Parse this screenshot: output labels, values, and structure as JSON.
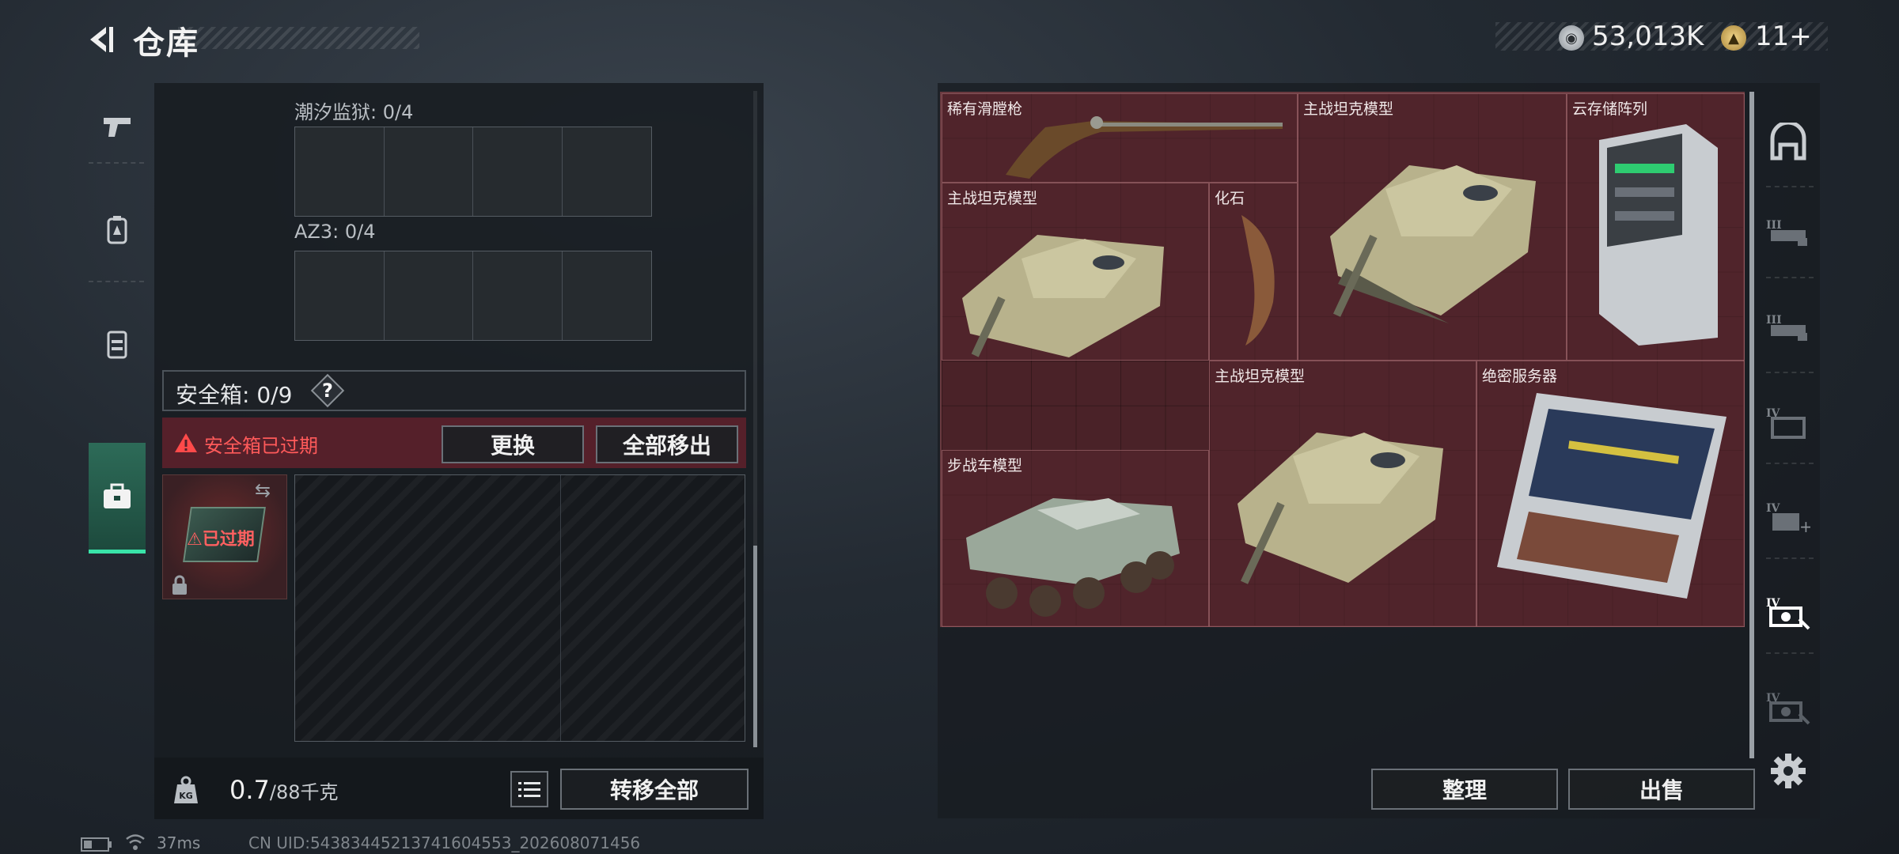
{
  "header": {
    "title": "仓库",
    "coin_value": "53,013K",
    "token_value": "11+"
  },
  "left_tabs": [
    "pistol-icon",
    "backpack-icon",
    "vest-icon",
    "safebox-icon"
  ],
  "storage": {
    "sections": [
      {
        "label": "潮汐监狱: 0/4"
      },
      {
        "label": "AZ3: 0/4"
      }
    ],
    "safebox": {
      "label": "安全箱: 0/9",
      "help": "?",
      "expired_message": "安全箱已过期",
      "replace_label": "更换",
      "remove_all_label": "全部移出",
      "item_status": "已过期"
    },
    "weight_current": "0.7",
    "weight_max": "/88千克",
    "transfer_all_label": "转移全部"
  },
  "stash": {
    "items": [
      {
        "label": "稀有滑膛枪"
      },
      {
        "label": "主战坦克模型"
      },
      {
        "label": "云存储阵列"
      },
      {
        "label": "主战坦克模型"
      },
      {
        "label": "化石"
      },
      {
        "label": "主战坦克模型"
      },
      {
        "label": "绝密服务器"
      },
      {
        "label": "步战车模型"
      }
    ],
    "sort_label": "整理",
    "sell_label": "出售"
  },
  "right_tabs": [
    "bunker-icon",
    "stash-iii-icon",
    "stash-iii-icon",
    "stash-iv-icon",
    "stash-iv-add-icon",
    "stash-iv-key-icon",
    "stash-iv-key-icon"
  ],
  "status": {
    "ping": "37ms",
    "uid": "CN UID:5438344521374160​4553_202608071456"
  }
}
